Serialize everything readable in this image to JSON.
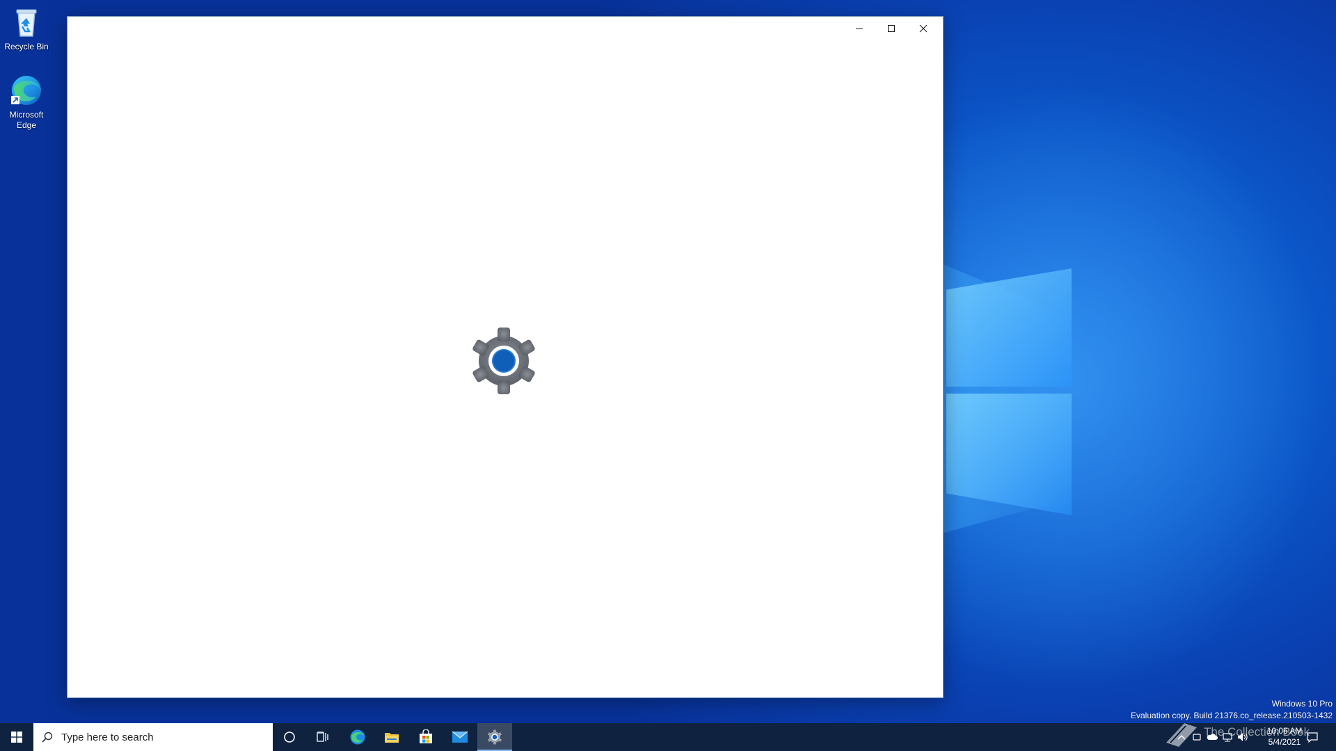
{
  "desktop": {
    "icons": [
      {
        "label": "Recycle Bin"
      },
      {
        "label": "Microsoft Edge"
      }
    ],
    "build_info": {
      "edition": "Windows 10 Pro",
      "build": "Evaluation copy. Build 21376.co_release.210503-1432"
    }
  },
  "window": {
    "controls": {
      "minimize": "minimize-icon",
      "maximize": "maximize-icon",
      "close": "close-icon"
    },
    "splash_icon": "gear-icon",
    "accent": "#0f5fb8"
  },
  "taskbar": {
    "search": {
      "placeholder": "Type here to search"
    },
    "pinned": [
      "cortana-icon",
      "task-view-icon",
      "edge-icon",
      "file-explorer-icon",
      "store-icon",
      "mail-icon",
      "settings-icon"
    ],
    "active_app": "settings-icon",
    "clock": {
      "time": "10:06 AM",
      "date": "5/4/2021"
    },
    "watermark": "The Collection Book"
  },
  "colors": {
    "taskbar_bg": "#0f2340",
    "desktop_blue": "#0a7ee0",
    "window_bg": "#ffffff"
  }
}
